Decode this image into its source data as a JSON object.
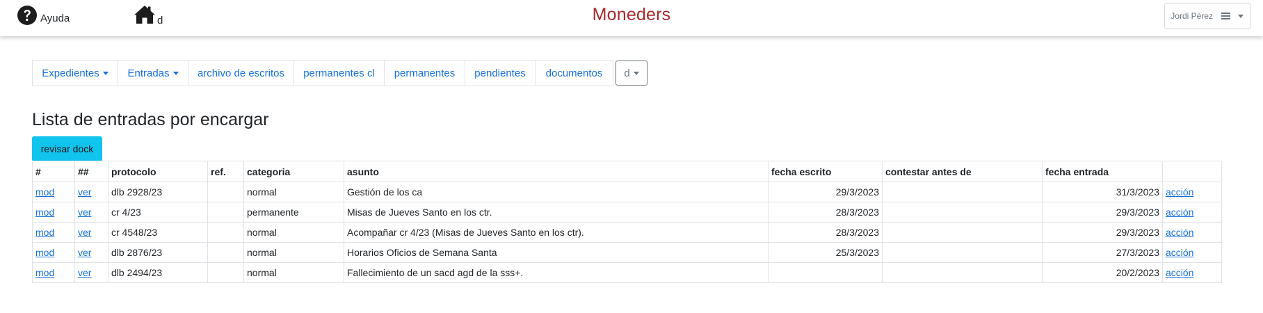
{
  "header": {
    "help_label": "Ayuda",
    "home_label": "d",
    "app_title": "Moneders",
    "user_name": "Jordi Pérez"
  },
  "colors": {
    "title": "#a8292c",
    "link": "#1570d9",
    "button_bg": "#10c4ee"
  },
  "icons": [
    "question-circle-icon",
    "home-icon",
    "hamburger-icon",
    "caret-down-icon"
  ],
  "nav": {
    "tabs": [
      {
        "label": "Expedientes",
        "dropdown": true
      },
      {
        "label": "Entradas",
        "dropdown": true
      },
      {
        "label": "archivo de escritos"
      },
      {
        "label": "permanentes cl"
      },
      {
        "label": "permanentes"
      },
      {
        "label": "pendientes"
      },
      {
        "label": "documentos"
      },
      {
        "label": "d",
        "dropdown": true
      }
    ]
  },
  "page": {
    "title": "Lista de entradas por encargar",
    "dock_button": "revisar dock"
  },
  "table": {
    "headers": [
      "#",
      "##",
      "protocolo",
      "ref.",
      "categoria",
      "asunto",
      "fecha escrito",
      "contestar antes de",
      "fecha entrada",
      ""
    ],
    "rows": [
      {
        "mod": "mod",
        "ver": "ver",
        "protocolo": "dlb 2928/23",
        "ref": "",
        "categoria": "normal",
        "asunto": "Gestión de los ca",
        "fecha_escrito": "29/3/2023",
        "contestar": "",
        "fecha_entrada": "31/3/2023",
        "accion": "acción"
      },
      {
        "mod": "mod",
        "ver": "ver",
        "protocolo": "cr 4/23",
        "ref": "",
        "categoria": "permanente",
        "asunto": "Misas de Jueves Santo en los ctr.",
        "fecha_escrito": "28/3/2023",
        "contestar": "",
        "fecha_entrada": "29/3/2023",
        "accion": "acción"
      },
      {
        "mod": "mod",
        "ver": "ver",
        "protocolo": "cr 4548/23",
        "ref": "",
        "categoria": "normal",
        "asunto": "Acompañar cr 4/23 (Misas de Jueves Santo en los ctr).",
        "fecha_escrito": "28/3/2023",
        "contestar": "",
        "fecha_entrada": "29/3/2023",
        "accion": "acción"
      },
      {
        "mod": "mod",
        "ver": "ver",
        "protocolo": "dlb 2876/23",
        "ref": "",
        "categoria": "normal",
        "asunto": "Horarios Oficios de Semana Santa",
        "fecha_escrito": "25/3/2023",
        "contestar": "",
        "fecha_entrada": "27/3/2023",
        "accion": "acción"
      },
      {
        "mod": "mod",
        "ver": "ver",
        "protocolo": "dlb 2494/23",
        "ref": "",
        "categoria": "normal",
        "asunto": "Fallecimiento de un sacd agd de la sss+.",
        "fecha_escrito": "",
        "contestar": "",
        "fecha_entrada": "20/2/2023",
        "accion": "acción"
      }
    ]
  }
}
